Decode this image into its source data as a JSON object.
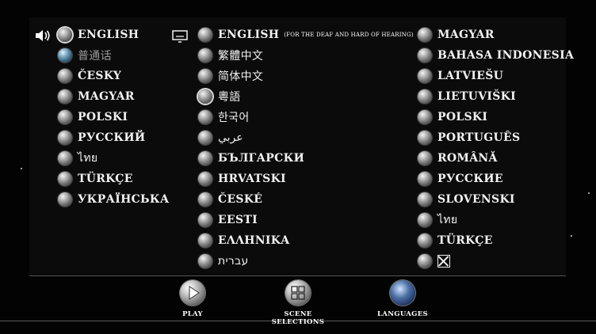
{
  "audio_icon": "speaker-icon",
  "subtitle_icon": "subtitle-screen-icon",
  "audio_languages": [
    {
      "label": "ENGLISH",
      "style": "selected"
    },
    {
      "label": "普通话",
      "style": "dim-blue"
    },
    {
      "label": "ČESKY",
      "style": "normal"
    },
    {
      "label": "MAGYAR",
      "style": "normal"
    },
    {
      "label": "POLSKI",
      "style": "normal"
    },
    {
      "label": "РУССКИЙ",
      "style": "normal"
    },
    {
      "label": "ไทย",
      "style": "normal"
    },
    {
      "label": "TÜRKÇE",
      "style": "normal"
    },
    {
      "label": "УКРАЇНСЬКА",
      "style": "normal"
    }
  ],
  "subtitles_col1": [
    {
      "label": "ENGLISH",
      "note": "(FOR THE DEAF AND HARD OF HEARING)"
    },
    {
      "label": "繁體中文"
    },
    {
      "label": "简体中文"
    },
    {
      "label": "粵語",
      "style": "selected"
    },
    {
      "label": "한국어"
    },
    {
      "label": "عربي"
    },
    {
      "label": "БЪЛГАРСКИ"
    },
    {
      "label": "HRVATSKI"
    },
    {
      "label": "ČESKÉ"
    },
    {
      "label": "EESTI"
    },
    {
      "label": "ΕΛΛΗΝΙΚΑ"
    },
    {
      "label": "עברית"
    }
  ],
  "subtitles_col2": [
    {
      "label": "MAGYAR"
    },
    {
      "label": "BAHASA INDONESIA"
    },
    {
      "label": "LATVIEŠU"
    },
    {
      "label": "LIETUVIŠKI"
    },
    {
      "label": "POLSKI"
    },
    {
      "label": "PORTUGUÊS"
    },
    {
      "label": "ROMÂNĂ"
    },
    {
      "label": "РУССКИЕ"
    },
    {
      "label": "SLOVENSKI"
    },
    {
      "label": "ไทย"
    },
    {
      "label": "TÜRKÇE"
    },
    {
      "label": "",
      "icon": "subtitles-off-icon"
    }
  ],
  "nav": {
    "play": "PLAY",
    "scenes": "SCENE SELECTIONS",
    "languages": "LANGUAGES"
  }
}
